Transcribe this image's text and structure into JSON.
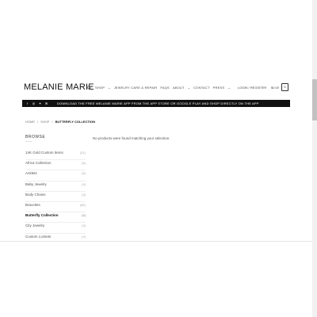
{
  "header": {
    "logo": "MELANIE MARIE",
    "nav": [
      {
        "label": "SHOP",
        "dropdown": true
      },
      {
        "label": "JEWELRY CARE & REPAIR",
        "dropdown": false
      },
      {
        "label": "FAQS",
        "dropdown": false
      },
      {
        "label": "ABOUT",
        "dropdown": true
      },
      {
        "label": "CONTACT",
        "dropdown": false
      },
      {
        "label": "PRESS",
        "dropdown": true
      }
    ],
    "account": "LOGIN / REGISTER",
    "cart_total": "$0.00",
    "cart_count": "0"
  },
  "banner": {
    "social_icons": [
      "facebook-icon",
      "instagram-icon",
      "twitter-icon",
      "email-icon"
    ],
    "text": "DOWNLOAD THE FREE MELANIE MARIE APP FROM THE APP STORE OR GOOGLE PLAY AND SHOP DIRECTLY ON THE APP"
  },
  "breadcrumb": {
    "items": [
      "HOME",
      "SHOP"
    ],
    "current": "BUTTERFLY COLLECTION"
  },
  "sidebar": {
    "title": "BROWSE",
    "categories": [
      {
        "label": "14K Gold Custom Items",
        "count": "(21)",
        "active": false
      },
      {
        "label": "Africa Collection",
        "count": "(6)",
        "active": false
      },
      {
        "label": "Anklets",
        "count": "(5)",
        "active": false
      },
      {
        "label": "Baby Jewelry",
        "count": "(9)",
        "active": false
      },
      {
        "label": "Body Chains",
        "count": "(3)",
        "active": false
      },
      {
        "label": "Bracelets",
        "count": "(80)",
        "active": false
      },
      {
        "label": "Butterfly Collection",
        "count": "(0)",
        "active": true
      },
      {
        "label": "City Jewelry",
        "count": "(0)",
        "active": false
      },
      {
        "label": "Custom Lockets",
        "count": "(0)",
        "active": false
      },
      {
        "label": "Ear Cuffs",
        "count": "(0)",
        "active": false
      }
    ]
  },
  "main": {
    "message": "No products were found matching your selection."
  }
}
